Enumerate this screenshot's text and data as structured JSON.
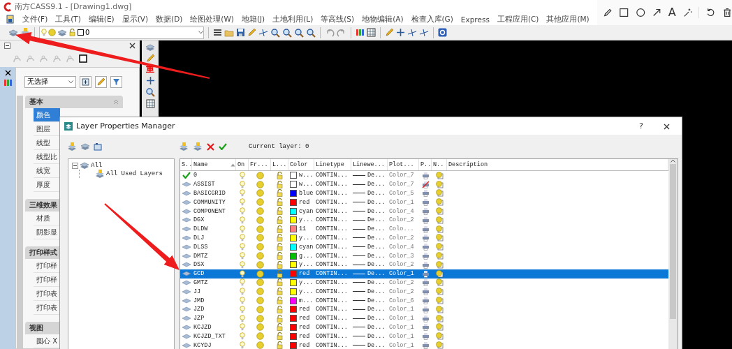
{
  "window": {
    "title": "南方CASS9.1 - [Drawing1.dwg]"
  },
  "markup_toolbar": {
    "text_tool": "A"
  },
  "menu": [
    "文件(F)",
    "工具(T)",
    "编辑(E)",
    "显示(V)",
    "数据(D)",
    "绘图处理(W)",
    "地籍(J)",
    "土地利用(L)",
    "等高线(S)",
    "地物编辑(A)",
    "检查入库(G)",
    "Express",
    "工程应用(C)",
    "其他应用(M)"
  ],
  "toolbar": {
    "layer_dropdown": {
      "value": "0"
    }
  },
  "side_toolbar": {
    "label": "重"
  },
  "properties_panel": {
    "selection": "无选择",
    "sections": [
      {
        "title": "基本",
        "items": [
          {
            "label": "颜色",
            "selected": true
          },
          {
            "label": "图层",
            "selected": false
          },
          {
            "label": "线型",
            "selected": false
          },
          {
            "label": "线型比",
            "selected": false
          },
          {
            "label": "线宽",
            "selected": false
          },
          {
            "label": "厚度",
            "selected": false
          }
        ]
      },
      {
        "title": "三维效果",
        "items": [
          {
            "label": "材质",
            "selected": false
          },
          {
            "label": "阴影显",
            "selected": false
          }
        ]
      },
      {
        "title": "打印样式",
        "items": [
          {
            "label": "打印样",
            "selected": false
          },
          {
            "label": "打印样",
            "selected": false
          },
          {
            "label": "打印表",
            "selected": false
          },
          {
            "label": "打印表",
            "selected": false
          }
        ]
      },
      {
        "title": "视图",
        "items": [
          {
            "label": "圆心 X",
            "selected": false
          }
        ]
      }
    ]
  },
  "layer_dialog": {
    "title": "Layer Properties Manager",
    "help": "?",
    "current_layer": "Current layer: 0",
    "tree": [
      {
        "label": "All",
        "expanded": true,
        "children": [
          {
            "label": "All Used Layers"
          }
        ]
      }
    ],
    "columns": [
      "S..",
      "Name",
      "On",
      "Fr...",
      "L...",
      "Color",
      "Linetype",
      "Linewe...",
      "Plot...",
      "P..",
      "N..",
      "Description"
    ],
    "rows": [
      {
        "current": true,
        "name": "0",
        "on": true,
        "frozen": false,
        "locked": false,
        "color_name": "w...",
        "color": "#ffffff",
        "linetype": "CONTIN...",
        "lineweight": "De...",
        "plot_style": "Color_7",
        "plot": true,
        "selected": false
      },
      {
        "current": false,
        "name": "ASSIST",
        "on": true,
        "frozen": false,
        "locked": false,
        "color_name": "w...",
        "color": "#ffffff",
        "linetype": "CONTIN...",
        "lineweight": "De...",
        "plot_style": "Color_7",
        "plot": false,
        "selected": false
      },
      {
        "current": false,
        "name": "BASICGRID",
        "on": true,
        "frozen": false,
        "locked": false,
        "color_name": "blue",
        "color": "#0000ff",
        "linetype": "CONTIN...",
        "lineweight": "De...",
        "plot_style": "Color_5",
        "plot": true,
        "selected": false
      },
      {
        "current": false,
        "name": "COMMUNITY",
        "on": true,
        "frozen": false,
        "locked": false,
        "color_name": "red",
        "color": "#ff0000",
        "linetype": "CONTIN...",
        "lineweight": "De...",
        "plot_style": "Color_1",
        "plot": true,
        "selected": false
      },
      {
        "current": false,
        "name": "COMPONENT",
        "on": true,
        "frozen": false,
        "locked": false,
        "color_name": "cyan",
        "color": "#00ffff",
        "linetype": "CONTIN...",
        "lineweight": "De...",
        "plot_style": "Color_4",
        "plot": true,
        "selected": false
      },
      {
        "current": false,
        "name": "DGX",
        "on": true,
        "frozen": false,
        "locked": false,
        "color_name": "y...",
        "color": "#ffff00",
        "linetype": "CONTIN...",
        "lineweight": "De...",
        "plot_style": "Color_2",
        "plot": true,
        "selected": false
      },
      {
        "current": false,
        "name": "DLDW",
        "on": true,
        "frozen": false,
        "locked": false,
        "color_name": "11",
        "color": "#ff8080",
        "linetype": "CONTIN...",
        "lineweight": "De...",
        "plot_style": "Colo...",
        "plot": true,
        "selected": false
      },
      {
        "current": false,
        "name": "DLJ",
        "on": true,
        "frozen": false,
        "locked": false,
        "color_name": "y...",
        "color": "#ffff00",
        "linetype": "CONTIN...",
        "lineweight": "De...",
        "plot_style": "Color_2",
        "plot": true,
        "selected": false
      },
      {
        "current": false,
        "name": "DLSS",
        "on": true,
        "frozen": false,
        "locked": false,
        "color_name": "cyan",
        "color": "#00ffff",
        "linetype": "CONTIN...",
        "lineweight": "De...",
        "plot_style": "Color_4",
        "plot": true,
        "selected": false
      },
      {
        "current": false,
        "name": "DMTZ",
        "on": true,
        "frozen": false,
        "locked": false,
        "color_name": "g...",
        "color": "#00c000",
        "linetype": "CONTIN...",
        "lineweight": "De...",
        "plot_style": "Color_3",
        "plot": true,
        "selected": false
      },
      {
        "current": false,
        "name": "DSX",
        "on": true,
        "frozen": false,
        "locked": false,
        "color_name": "y...",
        "color": "#ffff00",
        "linetype": "CONTIN...",
        "lineweight": "De...",
        "plot_style": "Color_2",
        "plot": true,
        "selected": false
      },
      {
        "current": false,
        "name": "GCD",
        "on": true,
        "frozen": false,
        "locked": false,
        "color_name": "red",
        "color": "#ff0000",
        "linetype": "CONTIN...",
        "lineweight": "De...",
        "plot_style": "Color_1",
        "plot": true,
        "selected": true
      },
      {
        "current": false,
        "name": "GMTZ",
        "on": true,
        "frozen": false,
        "locked": false,
        "color_name": "y...",
        "color": "#ffff00",
        "linetype": "CONTIN...",
        "lineweight": "De...",
        "plot_style": "Color_2",
        "plot": true,
        "selected": false
      },
      {
        "current": false,
        "name": "JJ",
        "on": true,
        "frozen": false,
        "locked": false,
        "color_name": "y...",
        "color": "#ffff00",
        "linetype": "CONTIN...",
        "lineweight": "De...",
        "plot_style": "Color_2",
        "plot": true,
        "selected": false
      },
      {
        "current": false,
        "name": "JMD",
        "on": true,
        "frozen": false,
        "locked": false,
        "color_name": "m...",
        "color": "#ff00ff",
        "linetype": "CONTIN...",
        "lineweight": "De...",
        "plot_style": "Color_6",
        "plot": true,
        "selected": false
      },
      {
        "current": false,
        "name": "JZD",
        "on": true,
        "frozen": false,
        "locked": false,
        "color_name": "red",
        "color": "#ff0000",
        "linetype": "CONTIN...",
        "lineweight": "De...",
        "plot_style": "Color_1",
        "plot": true,
        "selected": false
      },
      {
        "current": false,
        "name": "JZP",
        "on": true,
        "frozen": false,
        "locked": false,
        "color_name": "red",
        "color": "#ff0000",
        "linetype": "CONTIN...",
        "lineweight": "De...",
        "plot_style": "Color_1",
        "plot": true,
        "selected": false
      },
      {
        "current": false,
        "name": "KCJZD",
        "on": true,
        "frozen": false,
        "locked": false,
        "color_name": "red",
        "color": "#ff0000",
        "linetype": "CONTIN...",
        "lineweight": "De...",
        "plot_style": "Color_1",
        "plot": true,
        "selected": false
      },
      {
        "current": false,
        "name": "KCJZD_TXT",
        "on": true,
        "frozen": false,
        "locked": false,
        "color_name": "red",
        "color": "#ff0000",
        "linetype": "CONTIN...",
        "lineweight": "De...",
        "plot_style": "Color_1",
        "plot": true,
        "selected": false
      },
      {
        "current": false,
        "name": "KCYDJ",
        "on": true,
        "frozen": false,
        "locked": false,
        "color_name": "red",
        "color": "#ff0000",
        "linetype": "CONTIN...",
        "lineweight": "De...",
        "plot_style": "Color_1",
        "plot": true,
        "selected": false
      }
    ]
  }
}
